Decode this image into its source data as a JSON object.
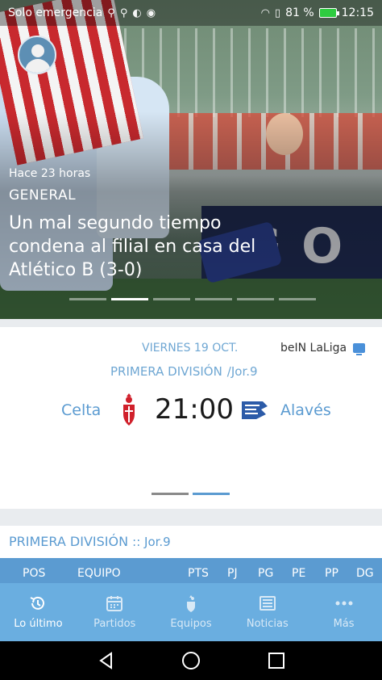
{
  "status_bar": {
    "carrier": "Solo emergencia",
    "battery_percent": "81 %",
    "time": "12:15",
    "icons": [
      "usb-icon",
      "usb-icon",
      "sync-icon",
      "location-icon",
      "wifi-icon",
      "sim-alert-icon",
      "battery-icon"
    ]
  },
  "hero": {
    "time_ago": "Hace 23 horas",
    "category": "GENERAL",
    "title": "Un mal segundo tiempo condena al filial en casa del Atlético B (3-0)",
    "board_text": "G O",
    "slides": 6,
    "active_slide": 2
  },
  "match": {
    "date": "VIERNES 19 OCT.",
    "tv": "beIN LaLiga",
    "competition": "PRIMERA DIVISIÓN",
    "round": "/Jor.9",
    "home_team": "Celta",
    "away_team": "Alavés",
    "kickoff": "21:00",
    "pages": 2,
    "active_page": 2
  },
  "standings": {
    "competition": "PRIMERA DIVISIÓN",
    "round": ":: Jor.9",
    "columns": [
      "POS",
      "EQUIPO",
      "PTS",
      "PJ",
      "PG",
      "PE",
      "PP",
      "DG"
    ]
  },
  "bottom_nav": [
    {
      "label": "Lo último",
      "icon": "history-icon",
      "active": true
    },
    {
      "label": "Partidos",
      "icon": "calendar-icon",
      "active": false
    },
    {
      "label": "Equipos",
      "icon": "crest-icon",
      "active": false
    },
    {
      "label": "Noticias",
      "icon": "newspaper-icon",
      "active": false
    },
    {
      "label": "Más",
      "icon": "more-icon",
      "active": false
    }
  ],
  "colors": {
    "accent": "#5b9bd1",
    "nav_bg": "#6aaee0",
    "header_blue": "#6fa7d3"
  }
}
